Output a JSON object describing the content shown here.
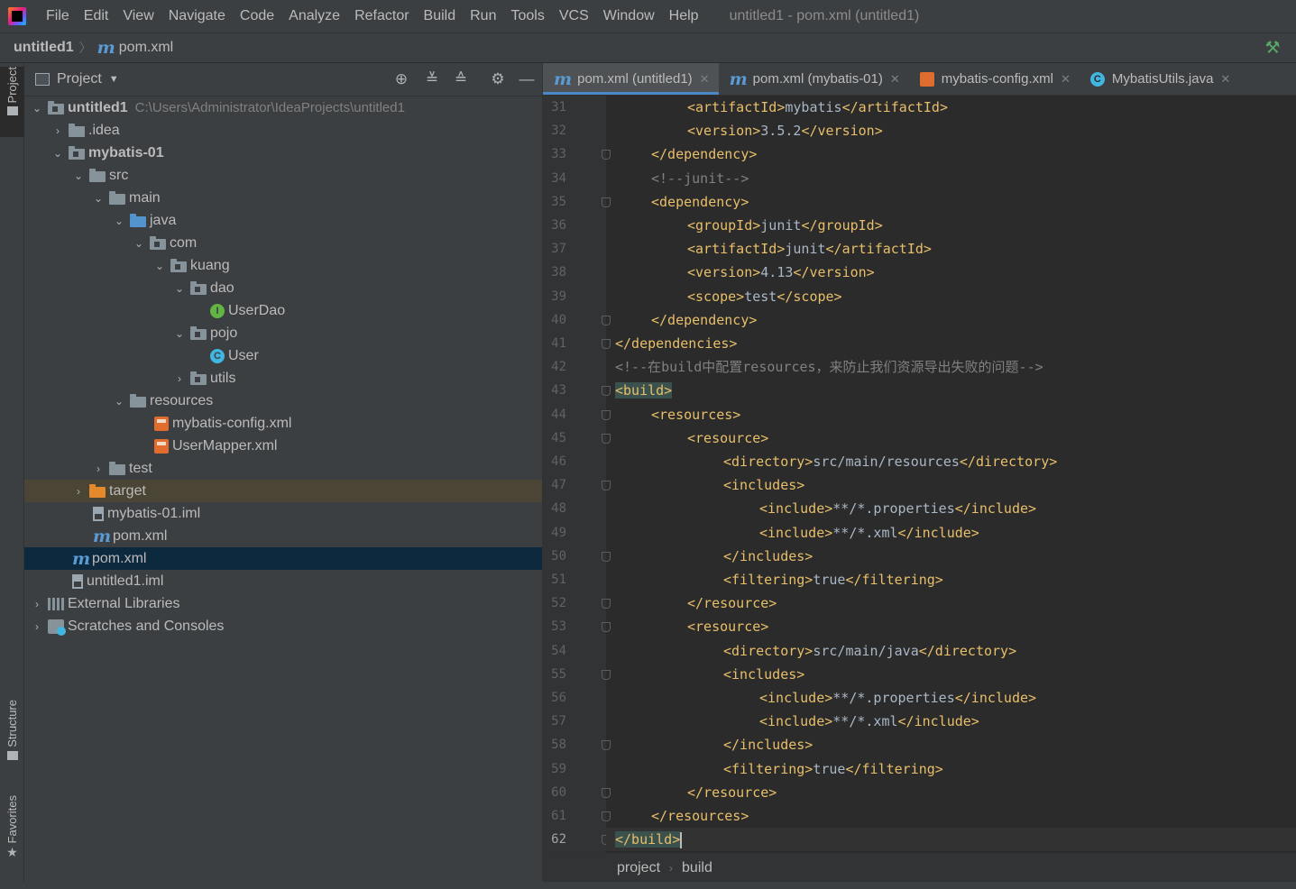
{
  "menubar": {
    "items": [
      "File",
      "Edit",
      "View",
      "Navigate",
      "Code",
      "Analyze",
      "Refactor",
      "Build",
      "Run",
      "Tools",
      "VCS",
      "Window",
      "Help"
    ],
    "title": "untitled1 - pom.xml (untitled1)"
  },
  "navbar": {
    "project": "untitled1",
    "file": "pom.xml"
  },
  "sidebar_tabs": {
    "project": "Project",
    "structure": "Structure",
    "favorites": "Favorites"
  },
  "project_panel": {
    "title": "Project",
    "tree": [
      {
        "label": "untitled1",
        "hint": "C:\\Users\\Administrator\\IdeaProjects\\untitled1"
      },
      {
        "label": ".idea"
      },
      {
        "label": "mybatis-01"
      },
      {
        "label": "src"
      },
      {
        "label": "main"
      },
      {
        "label": "java"
      },
      {
        "label": "com"
      },
      {
        "label": "kuang"
      },
      {
        "label": "dao"
      },
      {
        "label": "UserDao"
      },
      {
        "label": "pojo"
      },
      {
        "label": "User"
      },
      {
        "label": "utils"
      },
      {
        "label": "resources"
      },
      {
        "label": "mybatis-config.xml"
      },
      {
        "label": "UserMapper.xml"
      },
      {
        "label": "test"
      },
      {
        "label": "target"
      },
      {
        "label": "mybatis-01.iml"
      },
      {
        "label": "pom.xml"
      },
      {
        "label": "pom.xml"
      },
      {
        "label": "untitled1.iml"
      },
      {
        "label": "External Libraries"
      },
      {
        "label": "Scratches and Consoles"
      }
    ]
  },
  "tabs": [
    {
      "label": "pom.xml (untitled1)",
      "active": true
    },
    {
      "label": "pom.xml (mybatis-01)"
    },
    {
      "label": "mybatis-config.xml"
    },
    {
      "label": "MybatisUtils.java"
    }
  ],
  "editor": {
    "lines": [
      {
        "n": "31",
        "parts": [
          [
            "tag",
            "<artifactId>"
          ],
          [
            "txt",
            "mybatis"
          ],
          [
            "tag",
            "</artifactId>"
          ]
        ]
      },
      {
        "n": "32",
        "parts": [
          [
            "tag",
            "<version>"
          ],
          [
            "txt",
            "3.5.2"
          ],
          [
            "tag",
            "</version>"
          ]
        ]
      },
      {
        "n": "33",
        "parts": [
          [
            "tag",
            "</dependency>"
          ]
        ]
      },
      {
        "n": "34",
        "parts": [
          [
            "cmt",
            "<!--junit-->"
          ]
        ]
      },
      {
        "n": "35",
        "parts": [
          [
            "tag",
            "<dependency>"
          ]
        ]
      },
      {
        "n": "36",
        "parts": [
          [
            "tag",
            "<groupId>"
          ],
          [
            "txt",
            "junit"
          ],
          [
            "tag",
            "</groupId>"
          ]
        ]
      },
      {
        "n": "37",
        "parts": [
          [
            "tag",
            "<artifactId>"
          ],
          [
            "txt",
            "junit"
          ],
          [
            "tag",
            "</artifactId>"
          ]
        ]
      },
      {
        "n": "38",
        "parts": [
          [
            "tag",
            "<version>"
          ],
          [
            "txt",
            "4.13"
          ],
          [
            "tag",
            "</version>"
          ]
        ]
      },
      {
        "n": "39",
        "parts": [
          [
            "tag",
            "<scope>"
          ],
          [
            "txt",
            "test"
          ],
          [
            "tag",
            "</scope>"
          ]
        ]
      },
      {
        "n": "40",
        "parts": [
          [
            "tag",
            "</dependency>"
          ]
        ]
      },
      {
        "n": "41",
        "parts": [
          [
            "tag",
            "</dependencies>"
          ]
        ]
      },
      {
        "n": "42",
        "parts": [
          [
            "cmt",
            "<!--在build中配置resources，来防止我们资源导出失败的问题-->"
          ]
        ]
      },
      {
        "n": "43",
        "parts": [
          [
            "hl",
            "<build>"
          ]
        ]
      },
      {
        "n": "44",
        "parts": [
          [
            "tag",
            "<resources>"
          ]
        ]
      },
      {
        "n": "45",
        "parts": [
          [
            "tag",
            "<resource>"
          ]
        ]
      },
      {
        "n": "46",
        "parts": [
          [
            "tag",
            "<directory>"
          ],
          [
            "txt",
            "src/main/resources"
          ],
          [
            "tag",
            "</directory>"
          ]
        ]
      },
      {
        "n": "47",
        "parts": [
          [
            "tag",
            "<includes>"
          ]
        ]
      },
      {
        "n": "48",
        "parts": [
          [
            "tag",
            "<include>"
          ],
          [
            "txt",
            "**/*.properties"
          ],
          [
            "tag",
            "</include>"
          ]
        ]
      },
      {
        "n": "49",
        "parts": [
          [
            "tag",
            "<include>"
          ],
          [
            "txt",
            "**/*.xml"
          ],
          [
            "tag",
            "</include>"
          ]
        ]
      },
      {
        "n": "50",
        "parts": [
          [
            "tag",
            "</includes>"
          ]
        ]
      },
      {
        "n": "51",
        "parts": [
          [
            "tag",
            "<filtering>"
          ],
          [
            "txt",
            "true"
          ],
          [
            "tag",
            "</filtering>"
          ]
        ]
      },
      {
        "n": "52",
        "parts": [
          [
            "tag",
            "</resource>"
          ]
        ]
      },
      {
        "n": "53",
        "parts": [
          [
            "tag",
            "<resource>"
          ]
        ]
      },
      {
        "n": "54",
        "parts": [
          [
            "tag",
            "<directory>"
          ],
          [
            "txt",
            "src/main/java"
          ],
          [
            "tag",
            "</directory>"
          ]
        ]
      },
      {
        "n": "55",
        "parts": [
          [
            "tag",
            "<includes>"
          ]
        ]
      },
      {
        "n": "56",
        "parts": [
          [
            "tag",
            "<include>"
          ],
          [
            "txt",
            "**/*.properties"
          ],
          [
            "tag",
            "</include>"
          ]
        ]
      },
      {
        "n": "57",
        "parts": [
          [
            "tag",
            "<include>"
          ],
          [
            "txt",
            "**/*.xml"
          ],
          [
            "tag",
            "</include>"
          ]
        ]
      },
      {
        "n": "58",
        "parts": [
          [
            "tag",
            "</includes>"
          ]
        ]
      },
      {
        "n": "59",
        "parts": [
          [
            "tag",
            "<filtering>"
          ],
          [
            "txt",
            "true"
          ],
          [
            "tag",
            "</filtering>"
          ]
        ]
      },
      {
        "n": "60",
        "parts": [
          [
            "tag",
            "</resource>"
          ]
        ]
      },
      {
        "n": "61",
        "parts": [
          [
            "tag",
            "</resources>"
          ]
        ]
      },
      {
        "n": "62",
        "parts": [
          [
            "hl",
            "</build>"
          ]
        ]
      }
    ]
  },
  "editor_breadcrumbs": [
    "project",
    "build"
  ],
  "colors": {
    "tag": "#e8bf6a",
    "text": "#a9b7c6",
    "comment": "#808080",
    "selection": "#0d293e",
    "accent": "#4a88c7"
  }
}
